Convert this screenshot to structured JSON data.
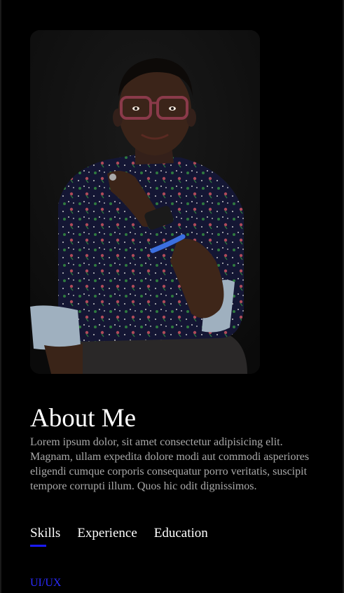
{
  "about": {
    "title": "About Me",
    "text": "Lorem ipsum dolor, sit amet consectetur adipisicing elit. Magnam, ullam expedita dolore modi aut commodi asperiores eligendi cumque corporis consequatur porro veritatis, suscipit tempore corrupti illum. Quos hic odit dignissimos."
  },
  "tabs": [
    {
      "label": "Skills",
      "active": true
    },
    {
      "label": "Experience",
      "active": false
    },
    {
      "label": "Education",
      "active": false
    }
  ],
  "skills": {
    "first_item": "UI/UX"
  },
  "colors": {
    "background": "#000000",
    "accent": "#1a1aff",
    "body_text": "#a9a9a9"
  }
}
